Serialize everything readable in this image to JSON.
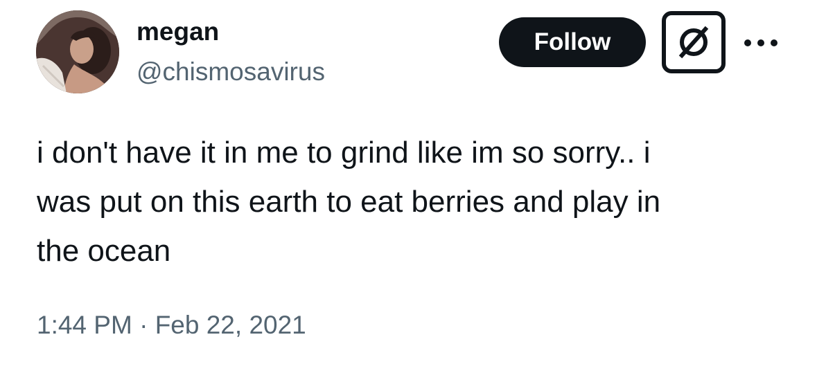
{
  "author": {
    "display_name": "megan",
    "handle": "@chismosavirus",
    "avatar_icon": "profile-photo"
  },
  "actions": {
    "follow_label": "Follow",
    "grok_icon": "grok-icon",
    "more_icon": "more-options-icon"
  },
  "tweet": {
    "lines": [
      "i don't have it in me to grind like im so sorry.. i",
      "was put on this earth to eat berries and play in",
      "the ocean"
    ],
    "time": "1:44 PM",
    "separator": "·",
    "date": "Feb 22, 2021"
  },
  "colors": {
    "text_primary": "#0f1419",
    "text_secondary": "#536471",
    "button_bg": "#0f1419",
    "button_text": "#ffffff"
  }
}
